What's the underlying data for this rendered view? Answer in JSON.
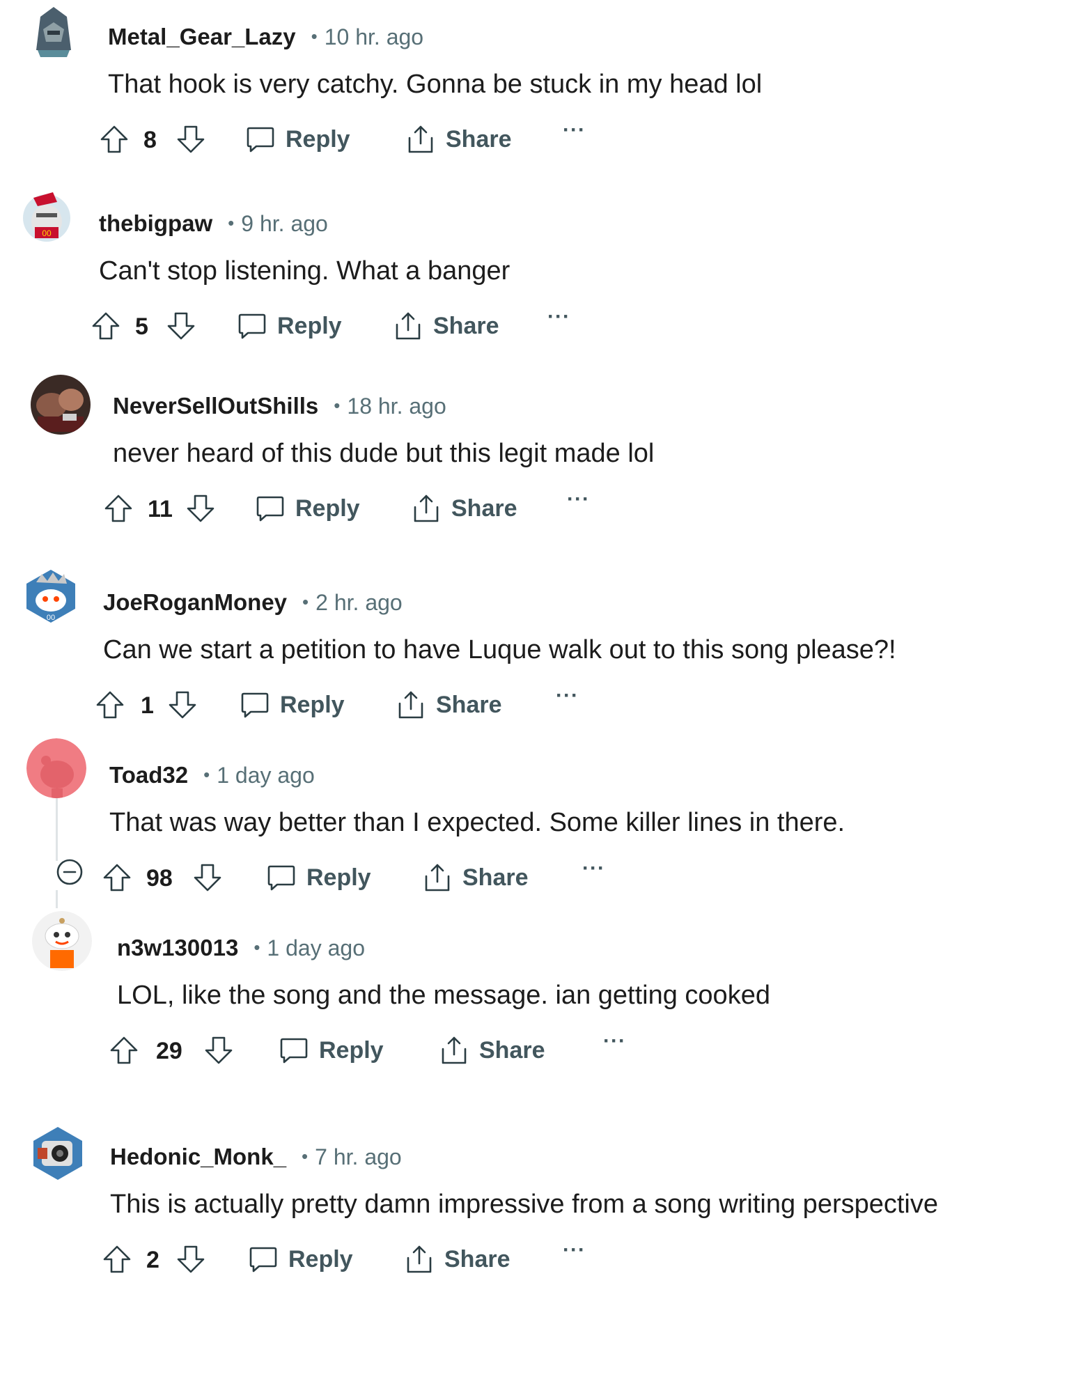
{
  "comments": [
    {
      "username": "Metal_Gear_Lazy",
      "time": "10 hr. ago",
      "text": "That hook is very catchy. Gonna be stuck in my head lol",
      "votes": "8",
      "reply_label": "Reply",
      "share_label": "Share",
      "more_label": "···",
      "avatar": "robot-helmet-avatar"
    },
    {
      "username": "thebigpaw",
      "time": "9 hr. ago",
      "text": "Can't stop listening. What a banger",
      "votes": "5",
      "reply_label": "Reply",
      "share_label": "Share",
      "more_label": "···",
      "avatar": "football-player-avatar"
    },
    {
      "username": "NeverSellOutShills",
      "time": "18 hr. ago",
      "text": "never heard of this dude but this legit made lol",
      "votes": "11",
      "reply_label": "Reply",
      "share_label": "Share",
      "more_label": "···",
      "avatar": "photo-avatar"
    },
    {
      "username": "JoeRoganMoney",
      "time": "2 hr. ago",
      "text": "Can we start a petition to have Luque walk out to this song please?!",
      "votes": "1",
      "reply_label": "Reply",
      "share_label": "Share",
      "more_label": "···",
      "avatar": "snoo-crown-avatar"
    },
    {
      "username": "Toad32",
      "time": "1 day ago",
      "text": "That was way better than I expected. Some killer lines in there.",
      "votes": "98",
      "reply_label": "Reply",
      "share_label": "Share",
      "more_label": "···",
      "avatar": "default-snoo-avatar"
    },
    {
      "username": "n3w130013",
      "time": "1 day ago",
      "text": "LOL, like the song and the message. ian getting cooked",
      "votes": "29",
      "reply_label": "Reply",
      "share_label": "Share",
      "more_label": "···",
      "avatar": "snoo-orange-shirt-avatar"
    },
    {
      "username": "Hedonic_Monk_",
      "time": "7 hr. ago",
      "text": "This is actually pretty damn impressive from a song writing perspective",
      "votes": "2",
      "reply_label": "Reply",
      "share_label": "Share",
      "more_label": "···",
      "avatar": "camera-robot-avatar"
    }
  ],
  "colors": {
    "username": "#1c1c1c",
    "meta": "#576f76",
    "icon": "#2a3c42",
    "default_avatar_bg": "#f07c83"
  }
}
